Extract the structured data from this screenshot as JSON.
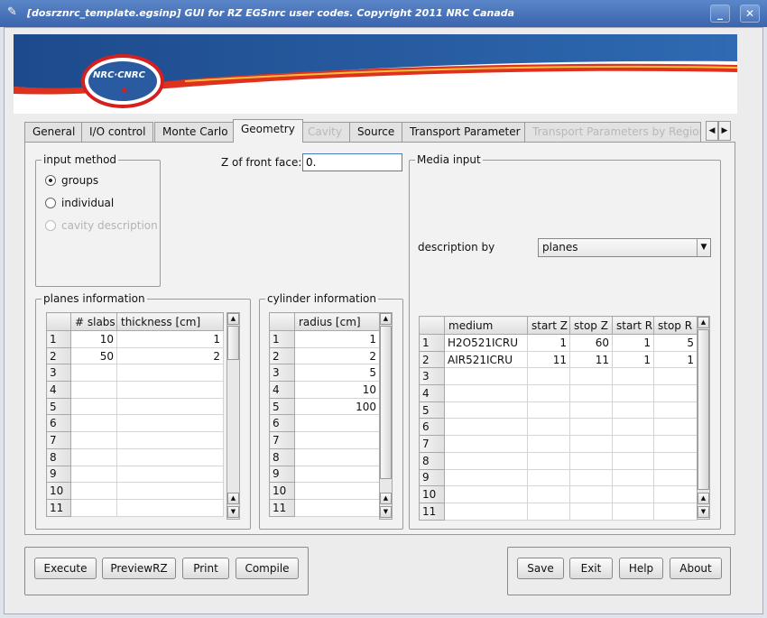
{
  "window": {
    "title": "[dosrznrc_template.egsinp] GUI for RZ EGSnrc user codes. Copyright 2011 NRC Canada",
    "app_icon": "feather-icon",
    "minimize_glyph": "_",
    "close_glyph": "✕"
  },
  "banner": {
    "logo_text": "NRC·CNRC"
  },
  "tabs": [
    {
      "label": "General",
      "state": "normal"
    },
    {
      "label": "I/O control",
      "state": "normal"
    },
    {
      "label": "Monte Carlo",
      "state": "normal"
    },
    {
      "label": "Geometry",
      "state": "active"
    },
    {
      "label": "Cavity",
      "state": "disabled"
    },
    {
      "label": "Source",
      "state": "normal"
    },
    {
      "label": "Transport Parameter",
      "state": "normal"
    },
    {
      "label": "Transport Parameters by Region",
      "state": "disabled"
    }
  ],
  "geometry": {
    "input_method": {
      "title": "input method",
      "options": [
        {
          "label": "groups",
          "selected": true,
          "enabled": true
        },
        {
          "label": "individual",
          "selected": false,
          "enabled": true
        },
        {
          "label": "cavity description",
          "selected": false,
          "enabled": false
        }
      ]
    },
    "z_front": {
      "label": "Z of front face:",
      "value": "0."
    },
    "planes": {
      "title": "planes information",
      "columns": [
        "# slabs",
        "thickness [cm]"
      ],
      "rows": [
        [
          "1",
          "10",
          "1"
        ],
        [
          "2",
          "50",
          "2"
        ],
        [
          "3",
          "",
          ""
        ],
        [
          "4",
          "",
          ""
        ],
        [
          "5",
          "",
          ""
        ],
        [
          "6",
          "",
          ""
        ],
        [
          "7",
          "",
          ""
        ],
        [
          "8",
          "",
          ""
        ],
        [
          "9",
          "",
          ""
        ],
        [
          "10",
          "",
          ""
        ],
        [
          "11",
          "",
          ""
        ]
      ]
    },
    "cylinders": {
      "title": "cylinder information",
      "columns": [
        "radius [cm]"
      ],
      "rows": [
        [
          "1",
          "1"
        ],
        [
          "2",
          "2"
        ],
        [
          "3",
          "5"
        ],
        [
          "4",
          "10"
        ],
        [
          "5",
          "100"
        ],
        [
          "6",
          ""
        ],
        [
          "7",
          ""
        ],
        [
          "8",
          ""
        ],
        [
          "9",
          ""
        ],
        [
          "10",
          ""
        ],
        [
          "11",
          ""
        ]
      ]
    },
    "media": {
      "title": "Media input",
      "description_label": "description by",
      "description_value": "planes",
      "columns": [
        "medium",
        "start Z",
        "stop Z",
        "start R",
        "stop R"
      ],
      "rows": [
        [
          "1",
          "H2O521ICRU",
          "1",
          "60",
          "1",
          "5"
        ],
        [
          "2",
          "AIR521ICRU",
          "11",
          "11",
          "1",
          "1"
        ],
        [
          "3",
          "",
          "",
          "",
          "",
          ""
        ],
        [
          "4",
          "",
          "",
          "",
          "",
          ""
        ],
        [
          "5",
          "",
          "",
          "",
          "",
          ""
        ],
        [
          "6",
          "",
          "",
          "",
          "",
          ""
        ],
        [
          "7",
          "",
          "",
          "",
          "",
          ""
        ],
        [
          "8",
          "",
          "",
          "",
          "",
          ""
        ],
        [
          "9",
          "",
          "",
          "",
          "",
          ""
        ],
        [
          "10",
          "",
          "",
          "",
          "",
          ""
        ],
        [
          "11",
          "",
          "",
          "",
          "",
          ""
        ]
      ]
    }
  },
  "buttons_left": [
    "Execute",
    "PreviewRZ",
    "Print",
    "Compile"
  ],
  "buttons_right": [
    "Save",
    "Exit",
    "Help",
    "About"
  ],
  "colors": {
    "titlebar": "#3a64ad",
    "banner_blue": "#1f4f8f",
    "banner_red": "#e0301e",
    "logo_red": "#d42020"
  }
}
